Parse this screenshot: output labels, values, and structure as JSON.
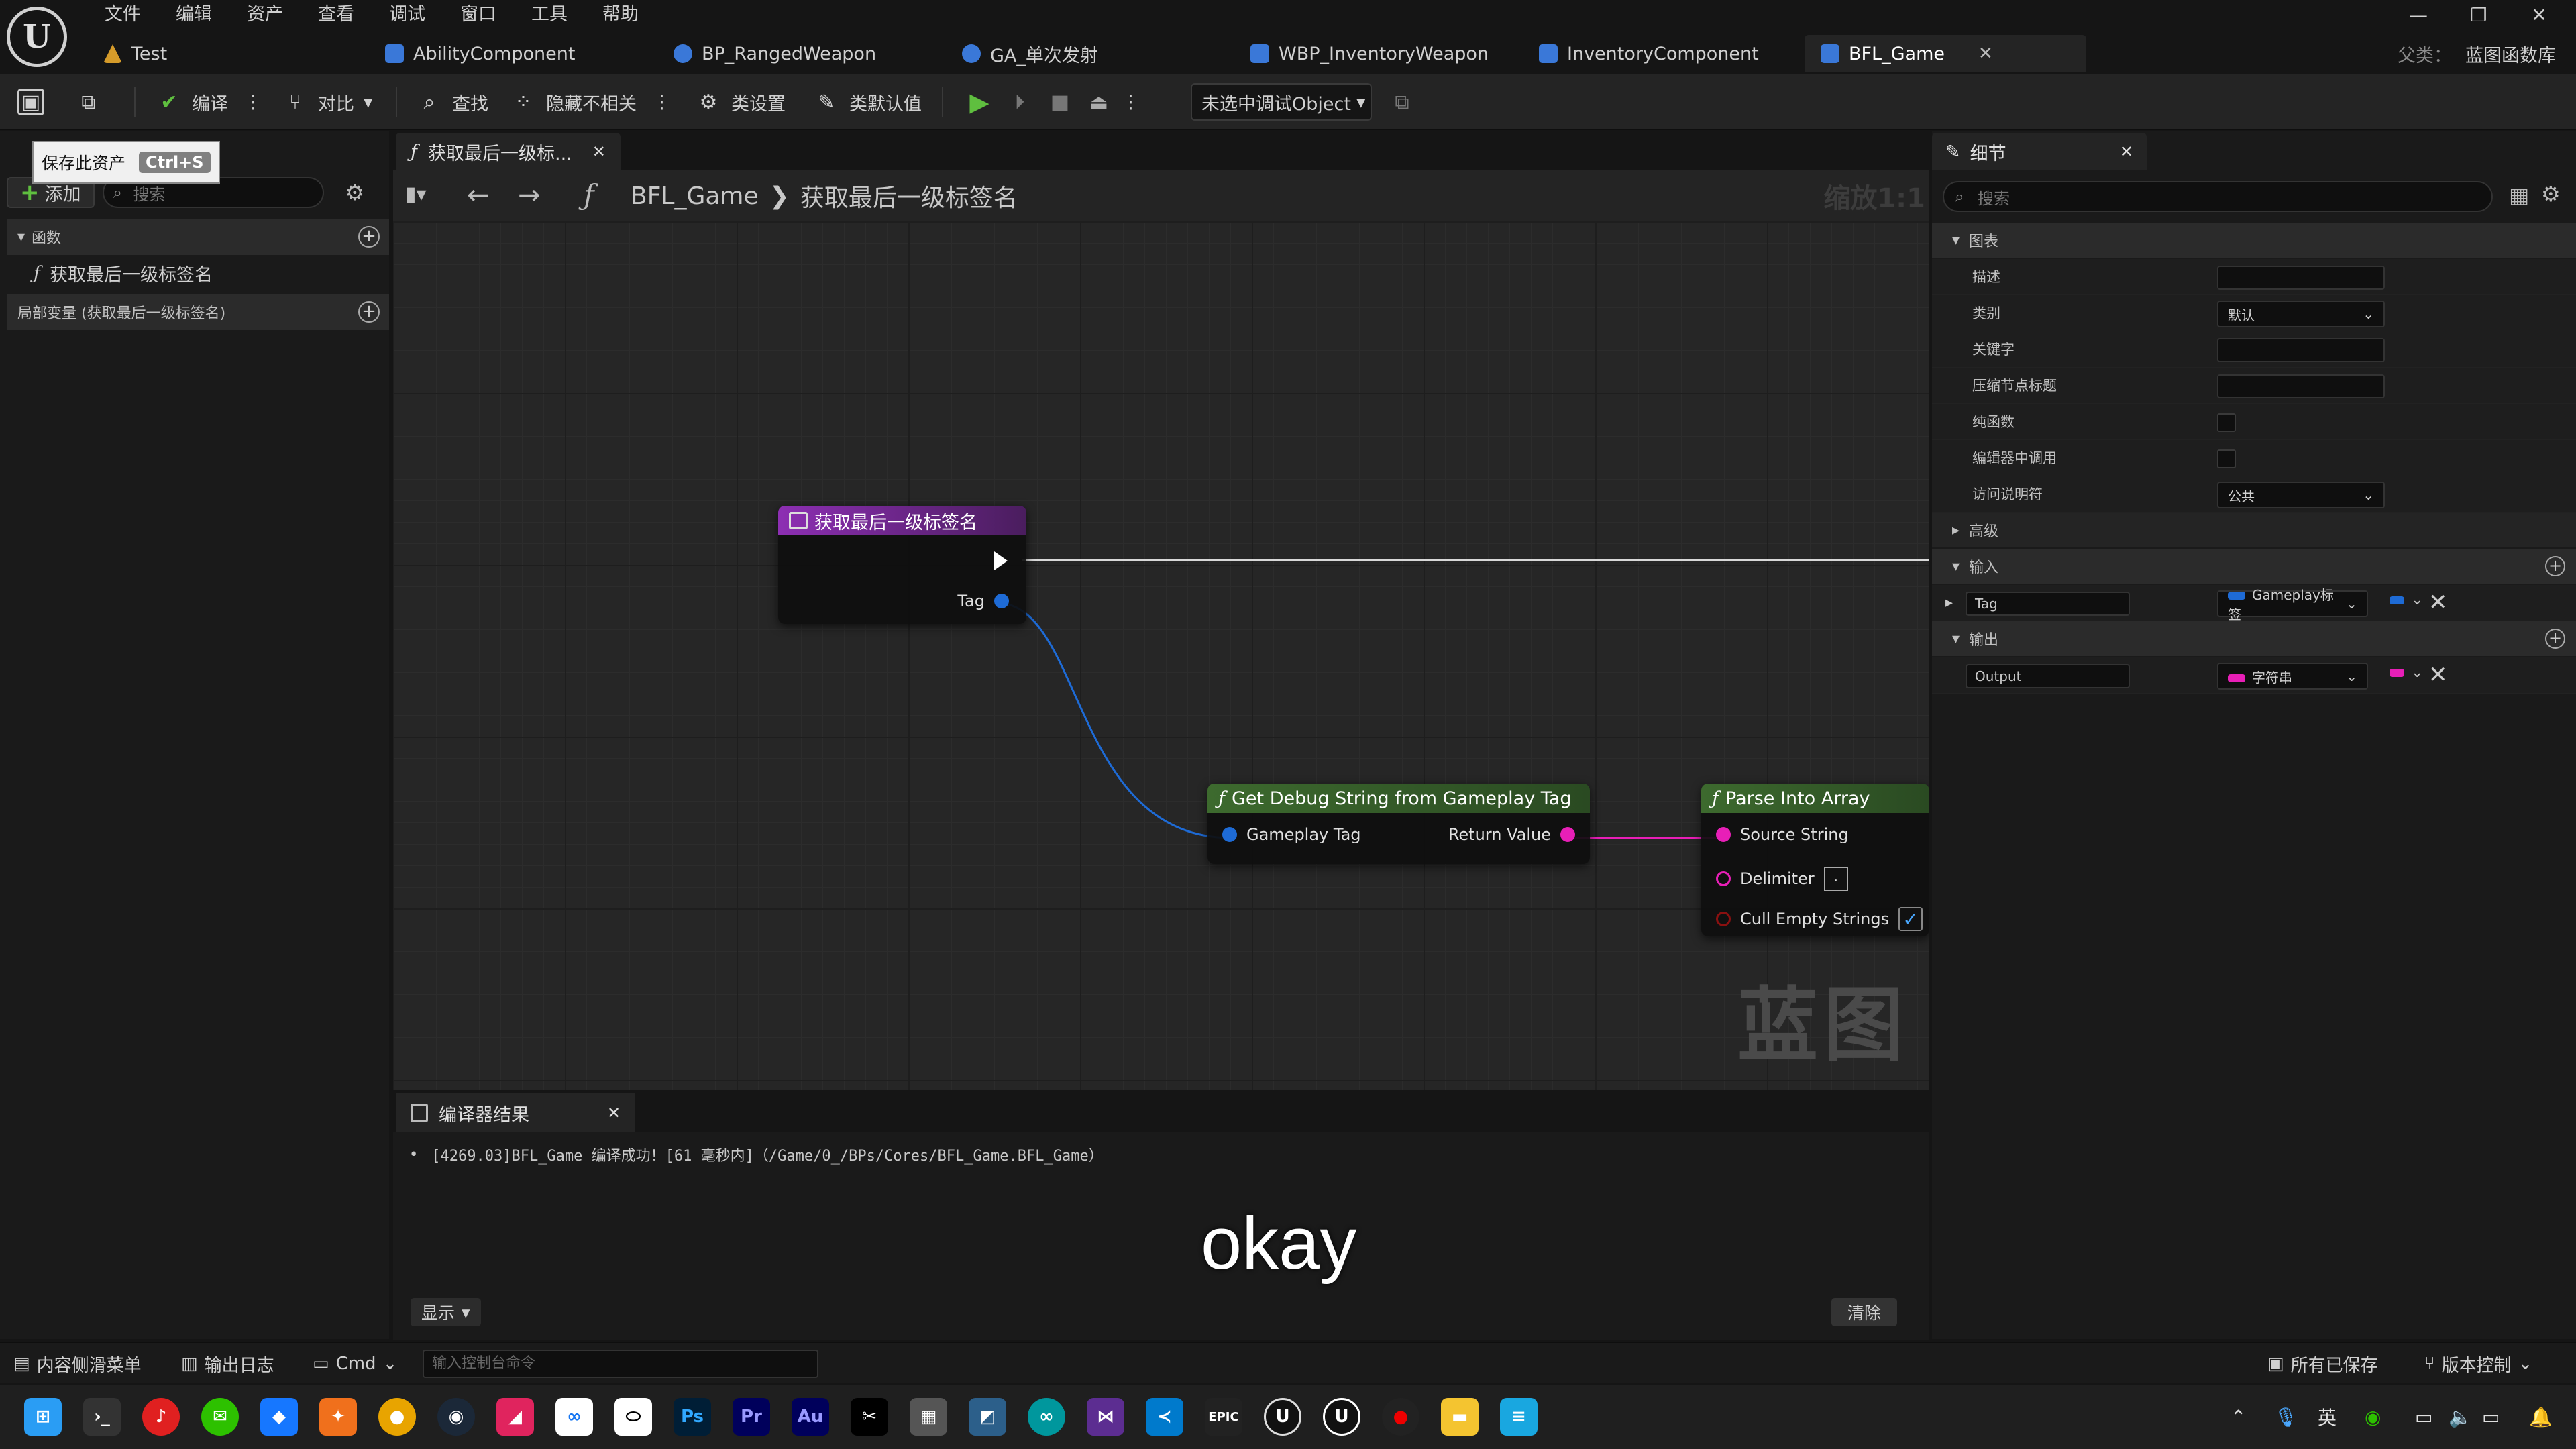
{
  "app": {
    "logo_letter": "U",
    "menu": [
      "文件",
      "编辑",
      "资产",
      "查看",
      "调试",
      "窗口",
      "工具",
      "帮助"
    ],
    "window_controls": [
      "—",
      "❐",
      "✕"
    ],
    "tabs": [
      {
        "label": "Test",
        "color": "#d59b2a"
      },
      {
        "label": "AbilityComponent",
        "color": "#3a78d8"
      },
      {
        "label": "BP_RangedWeapon",
        "color": "#3a78d8"
      },
      {
        "label": "GA_单次发射",
        "color": "#3a78d8"
      },
      {
        "label": "WBP_InventoryWeapon",
        "color": "#3a78d8"
      },
      {
        "label": "InventoryComponent",
        "color": "#3a78d8"
      },
      {
        "label": "BFL_Game",
        "color": "#3a78d8",
        "close": "✕"
      }
    ],
    "parent_class_label": "父类：",
    "parent_class_value": "蓝图函数库"
  },
  "toolbar": {
    "compile": "编译",
    "diff": "对比",
    "find": "查找",
    "hide_unrelated": "隐藏不相关",
    "class_settings": "类设置",
    "class_defaults": "类默认值",
    "debug_object": "未选中调试Object",
    "more": "⋮",
    "caret": "▾"
  },
  "tooltip": {
    "text": "保存此资产",
    "shortcut": "Ctrl+S"
  },
  "my_blueprint": {
    "add_label": "添加",
    "search_placeholder": "搜索",
    "functions_section": "函数",
    "function_item": "获取最后一级标签名",
    "local_vars_section": "局部变量 (获取最后一级标签名)"
  },
  "graph": {
    "tab_label": "获取最后一级标...",
    "tab_close": "✕",
    "breadcrumb_root": "BFL_Game",
    "breadcrumb_sep": "❯",
    "breadcrumb_leaf": "获取最后一级标签名",
    "zoom": "缩放1:1",
    "watermark": "蓝图",
    "entry_node": {
      "title": "获取最后一级标签名",
      "pin_tag": "Tag"
    },
    "debug_node": {
      "title": "Get Debug String from Gameplay Tag",
      "pin_in": "Gameplay Tag",
      "pin_out": "Return Value"
    },
    "parse_node": {
      "title": "Parse Into Array",
      "pin_source": "Source String",
      "pin_delimiter": "Delimiter",
      "delimiter_value": ".",
      "pin_cull": "Cull Empty Strings",
      "cull_checked": "✓"
    },
    "colors": {
      "entry_header": "#8d2fb3",
      "func_header": "#3d6a2e",
      "gameplay_tag_pin": "#1e6bd6",
      "string_pin": "#e81fb7"
    }
  },
  "compiler": {
    "tab_label": "编译器结果",
    "tab_close": "✕",
    "message": "[4269.03]BFL_Game 编译成功！[61 毫秒内]（/Game/0_/BPs/Cores/BFL_Game.BFL_Game）",
    "show_label": "显示",
    "clear_label": "清除"
  },
  "subtitle": "okay",
  "details": {
    "tab_label": "细节",
    "tab_close": "✕",
    "search_placeholder": "搜索",
    "graph_section": "图表",
    "rows": {
      "description": "描述",
      "category": "类别",
      "category_value": "默认",
      "keywords": "关键字",
      "compact_title": "压缩节点标题",
      "pure": "纯函数",
      "call_in_editor": "编辑器中调用",
      "access": "访问说明符",
      "access_value": "公共"
    },
    "advanced_section": "高级",
    "inputs_section": "输入",
    "input_name": "Tag",
    "input_type": "Gameplay标签",
    "outputs_section": "输出",
    "output_name": "Output",
    "output_type": "字符串"
  },
  "statusbar": {
    "content_drawer": "内容侧滑菜单",
    "output_log": "输出日志",
    "cmd": "Cmd",
    "console_placeholder": "输入控制台命令",
    "all_saved": "所有已保存",
    "source_control": "版本控制"
  },
  "taskbar": {
    "tray_lang": "英"
  }
}
